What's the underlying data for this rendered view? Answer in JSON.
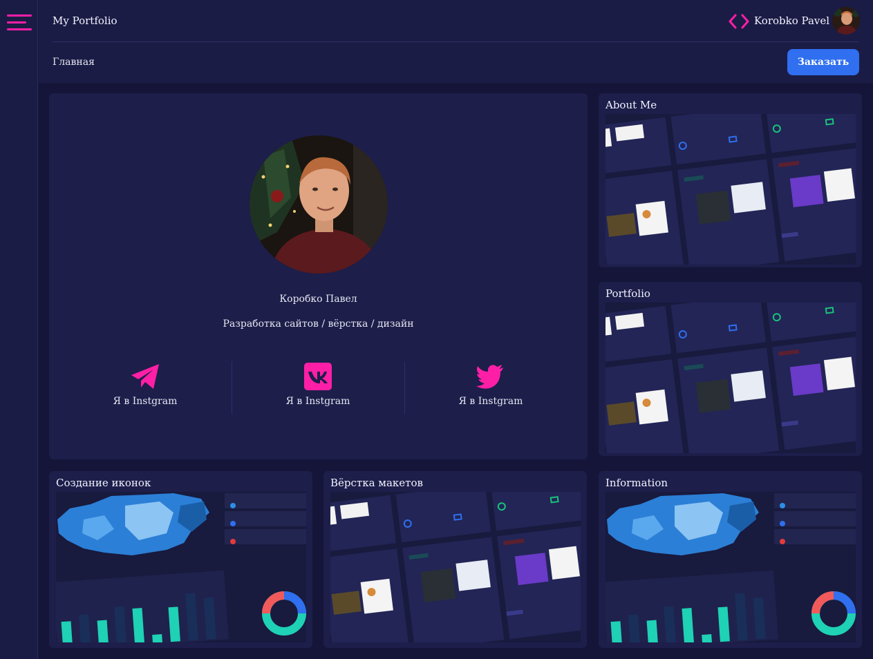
{
  "app": {
    "title": "My Portfolio"
  },
  "header": {
    "user_name": "Korobko Pavel",
    "breadcrumb": "Главная",
    "order_label": "Заказать"
  },
  "colors": {
    "accent": "#ff1fa6",
    "primary": "#2f6ff0",
    "background": "#141538",
    "card": "#1d1e4a"
  },
  "profile": {
    "name": "Коробко Павел",
    "role": "Разработка сайтов / вёрстка / дизайн",
    "socials": [
      {
        "icon": "telegram-icon",
        "label": "Я в Instgram"
      },
      {
        "icon": "vk-icon",
        "label": "Я в Instgram"
      },
      {
        "icon": "twitter-icon",
        "label": "Я в Instgram"
      }
    ]
  },
  "cards": {
    "about": {
      "title": "About Me"
    },
    "portfolio": {
      "title": "Portfolio"
    },
    "icons": {
      "title": "Создание иконок"
    },
    "layout": {
      "title": "Вёрстка макетов"
    },
    "info": {
      "title": "Information"
    }
  }
}
